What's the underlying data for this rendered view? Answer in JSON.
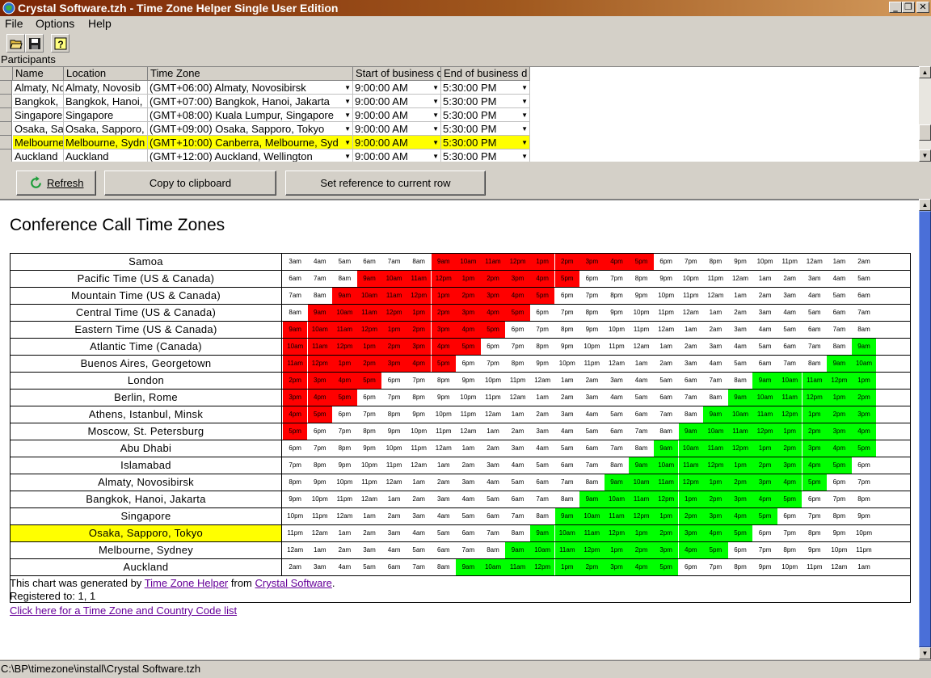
{
  "window": {
    "title": "Crystal Software.tzh - Time Zone Helper Single User Edition"
  },
  "menu": {
    "file": "File",
    "options": "Options",
    "help": "Help"
  },
  "participants": {
    "label": "Participants",
    "headers": [
      "Name",
      "Location",
      "Time Zone",
      "Start of business d",
      "End of business d"
    ],
    "rows": [
      [
        "Almaty, No",
        "Almaty, Novosib",
        "(GMT+06:00) Almaty, Novosibirsk",
        "9:00:00 AM",
        "5:30:00 PM"
      ],
      [
        "Bangkok,",
        "Bangkok, Hanoi,",
        "(GMT+07:00) Bangkok, Hanoi, Jakarta",
        "9:00:00 AM",
        "5:30:00 PM"
      ],
      [
        "Singapore",
        "Singapore",
        "(GMT+08:00) Kuala Lumpur, Singapore",
        "9:00:00 AM",
        "5:30:00 PM"
      ],
      [
        "Osaka, Sa",
        "Osaka, Sapporo,",
        "(GMT+09:00) Osaka, Sapporo, Tokyo",
        "9:00:00 AM",
        "5:30:00 PM"
      ],
      [
        "Melbourne",
        "Melbourne, Sydn",
        "(GMT+10:00) Canberra, Melbourne, Syd",
        "9:00:00 AM",
        "5:30:00 PM"
      ],
      [
        "Auckland",
        "Auckland",
        "(GMT+12:00) Auckland, Wellington",
        "9:00:00 AM",
        "5:30:00 PM"
      ]
    ],
    "selected_row": 4
  },
  "buttons": {
    "refresh": "Refresh",
    "copy": "Copy to clipboard",
    "set_reference": "Set reference to current row"
  },
  "chart": {
    "title": "Conference Call Time Zones",
    "highlight_row": 16,
    "zones": [
      {
        "name": "Samoa",
        "start": 3,
        "red": [
          6,
          14
        ],
        "green": null
      },
      {
        "name": "Pacific Time (US & Canada)",
        "start": 6,
        "red": [
          3,
          11
        ],
        "green": null
      },
      {
        "name": "Mountain Time (US & Canada)",
        "start": 7,
        "red": [
          2,
          10
        ],
        "green": null
      },
      {
        "name": "Central Time (US & Canada)",
        "start": 8,
        "red": [
          1,
          9
        ],
        "green": null
      },
      {
        "name": "Eastern Time (US & Canada)",
        "start": 9,
        "red": [
          0,
          8
        ],
        "green": null
      },
      {
        "name": "Atlantic Time (Canada)",
        "start": 10,
        "red": [
          0,
          7
        ],
        "green": [
          23,
          23
        ]
      },
      {
        "name": "Buenos Aires, Georgetown",
        "start": 11,
        "red": [
          0,
          6
        ],
        "green": [
          22,
          23
        ]
      },
      {
        "name": "London",
        "start": 14,
        "red": [
          0,
          3
        ],
        "green": [
          19,
          23
        ]
      },
      {
        "name": "Berlin, Rome",
        "start": 15,
        "red": [
          0,
          2
        ],
        "green": [
          18,
          23
        ]
      },
      {
        "name": "Athens, Istanbul, Minsk",
        "start": 16,
        "red": [
          0,
          1
        ],
        "green": [
          17,
          23
        ]
      },
      {
        "name": "Moscow, St. Petersburg",
        "start": 17,
        "red": [
          0,
          0
        ],
        "green": [
          16,
          23
        ]
      },
      {
        "name": "Abu Dhabi",
        "start": 18,
        "red": null,
        "green": [
          15,
          23
        ]
      },
      {
        "name": "Islamabad",
        "start": 19,
        "red": null,
        "green": [
          14,
          22
        ]
      },
      {
        "name": "Almaty, Novosibirsk",
        "start": 20,
        "red": null,
        "green": [
          13,
          21
        ]
      },
      {
        "name": "Bangkok, Hanoi, Jakarta",
        "start": 21,
        "red": null,
        "green": [
          12,
          20
        ]
      },
      {
        "name": "Singapore",
        "start": 22,
        "red": null,
        "green": [
          11,
          19
        ]
      },
      {
        "name": "Osaka, Sapporo, Tokyo",
        "start": 23,
        "red": null,
        "green": [
          10,
          18
        ]
      },
      {
        "name": "Melbourne, Sydney",
        "start": 0,
        "red": null,
        "green": [
          9,
          17
        ]
      },
      {
        "name": "Auckland",
        "start": 2,
        "red": null,
        "green": [
          7,
          15
        ]
      }
    ],
    "footer_prefix": "This chart was generated by",
    "footer_link1": "Time Zone Helper",
    "footer_mid": "from",
    "footer_link2": "Crystal Software",
    "footer_suffix": ".",
    "registered": "Registered to: 1, 1",
    "code_link": "Click here for a Time Zone and Country Code list"
  },
  "status": {
    "path": "C:\\BP\\timezone\\install\\Crystal Software.tzh"
  },
  "colors": {
    "business_ref": "#ff0000",
    "business_local": "#00ff00",
    "highlight": "#ffff00"
  }
}
